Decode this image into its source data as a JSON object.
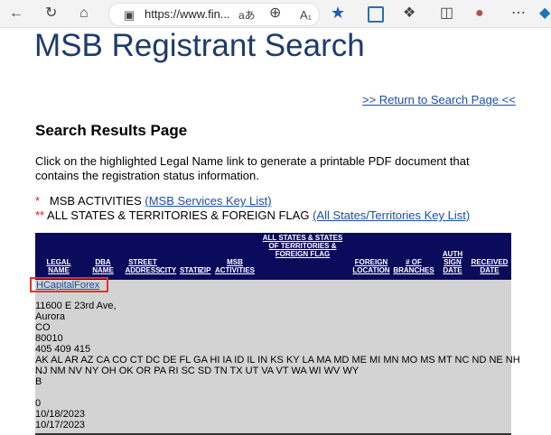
{
  "browser": {
    "url": "https://www.fin...",
    "icons": [
      "back-icon",
      "refresh-icon",
      "home-icon",
      "lock-icon",
      "read-aloud-icon",
      "zoom-icon",
      "text-size-icon",
      "favorite-star-icon",
      "collection-icon",
      "extensions-icon",
      "split-icon",
      "profile-icon",
      "more-icon"
    ]
  },
  "page": {
    "title": "MSB Registrant Search",
    "return_link": ">> Return to Search Page <<",
    "heading": "Search Results Page",
    "intro": "Click on the highlighted Legal Name link to generate a printable PDF document that contains the registration status information.",
    "legend1_star": "*",
    "legend1_text": "MSB ACTIVITIES",
    "legend1_link": "(MSB Services Key List)",
    "legend2_star": "**",
    "legend2_text": "ALL STATES & TERRITORIES & FOREIGN FLAG",
    "legend2_link": "(All States/Territories Key List)"
  },
  "table": {
    "headers": {
      "legal_name": "LEGAL NAME",
      "dba_name": "DBA NAME",
      "street_address": "STREET ADDRESS",
      "city": "CITY",
      "state": "STATE",
      "zip": "ZIP",
      "activities": "ACTIVITIES",
      "msb_activities": "MSB ACTIVITIES",
      "all_states": "ALL STATES & STATES OF TERRITORIES & FOREIGN FLAG",
      "territories_mid": "TERRITORIES & FOREIGN FLAG",
      "foreign_location": "FOREIGN LOCATION",
      "branches": "# OF BRANCHES",
      "auth_sign_date": "AUTH SIGN DATE",
      "received_date": "RECEIVED DATE"
    },
    "row": {
      "legal_name": "HCapitalForex",
      "street": "11600 E 23rd Ave,",
      "city": "Aurora",
      "state": "CO",
      "zip": "80010",
      "activities": "405 409 415",
      "states_line1": "AK AL AR AZ CA CO CT DC DE FL GA HI IA ID IL IN KS KY LA MA MD ME MI MN MO MS MT NC ND NE NH",
      "states_line2": "NJ NM NV NY OH OK OR PA RI SC SD TN TX UT VA VT WA WI WV WY",
      "foreign_flag": "B",
      "branches": "0",
      "auth_sign_date": "10/18/2023",
      "received_date": "10/17/2023"
    }
  }
}
